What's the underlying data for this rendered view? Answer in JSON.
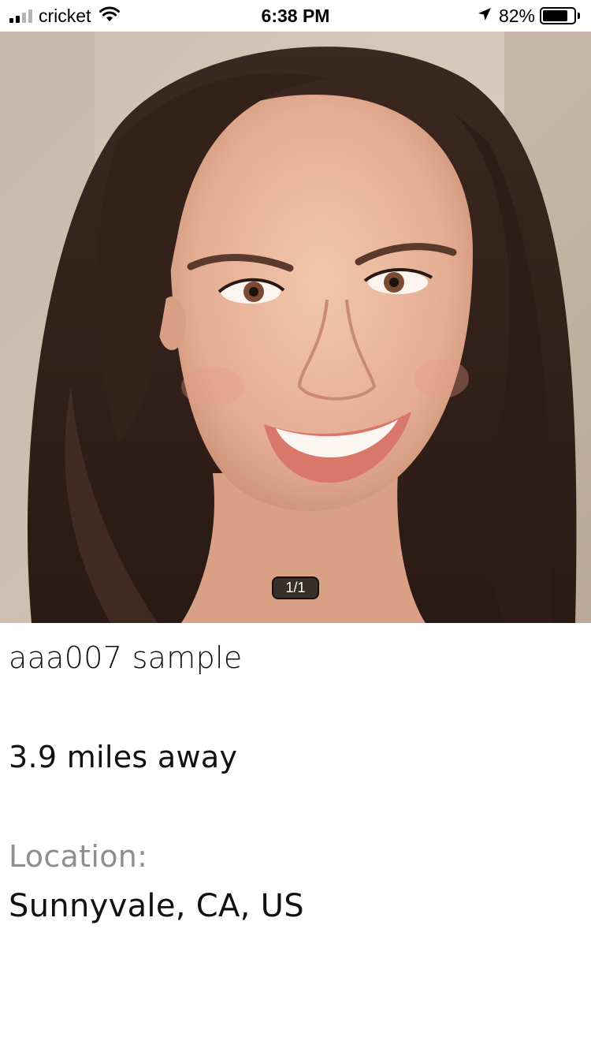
{
  "status_bar": {
    "carrier": "cricket",
    "time": "6:38 PM",
    "battery_percent": "82%",
    "battery_level": 0.82,
    "signal_bars_filled": 2,
    "signal_bars_total": 4,
    "icons": [
      "signal-icon",
      "wifi-icon",
      "location-arrow-icon",
      "battery-icon"
    ]
  },
  "photo": {
    "pager": "1/1"
  },
  "profile": {
    "username": "aaa007 sample",
    "distance": "3.9 miles away",
    "location_label": "Location:",
    "location_value": "Sunnyvale, CA, US"
  },
  "colors": {
    "label_gray": "#8e8e8e",
    "pager_bg": "#28221c"
  }
}
